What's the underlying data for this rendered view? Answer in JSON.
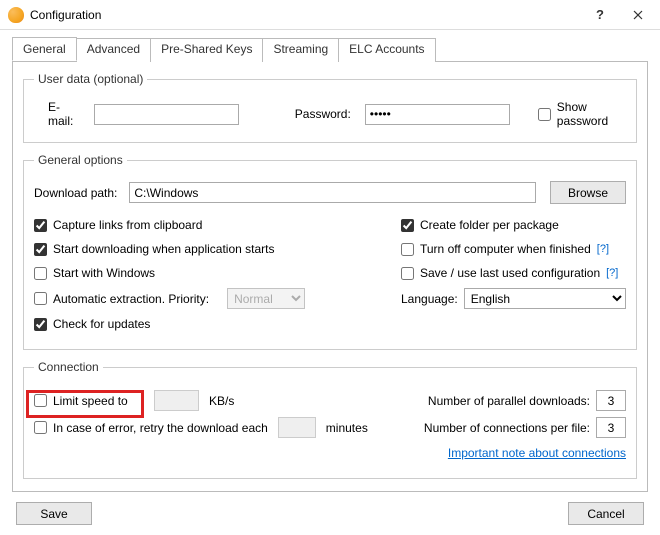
{
  "window": {
    "title": "Configuration"
  },
  "tabs": {
    "general": "General",
    "advanced": "Advanced",
    "preshared": "Pre-Shared Keys",
    "streaming": "Streaming",
    "elc": "ELC Accounts"
  },
  "userdata": {
    "legend": "User data (optional)",
    "email_label": "E-mail:",
    "email_value": "",
    "password_label": "Password:",
    "password_value": "•••••",
    "show_password_label": "Show password",
    "show_password_checked": false
  },
  "general_options": {
    "legend": "General options",
    "download_path_label": "Download path:",
    "download_path_value": "C:\\Windows",
    "browse_label": "Browse",
    "left": {
      "capture_links": {
        "label": "Capture links from clipboard",
        "checked": true
      },
      "start_downloading": {
        "label": "Start downloading when application starts",
        "checked": true
      },
      "start_with_windows": {
        "label": "Start with Windows",
        "checked": false
      },
      "auto_extract": {
        "label": "Automatic extraction. Priority:",
        "checked": false,
        "priority": "Normal"
      },
      "check_updates": {
        "label": "Check for updates",
        "checked": true
      }
    },
    "right": {
      "create_folder": {
        "label": "Create folder per package",
        "checked": true
      },
      "turn_off": {
        "label": "Turn off computer when finished",
        "checked": false
      },
      "save_last": {
        "label": "Save / use last used configuration",
        "checked": false
      },
      "language_label": "Language:",
      "language_value": "English"
    }
  },
  "connection": {
    "legend": "Connection",
    "limit_speed": {
      "label": "Limit speed to",
      "checked": false,
      "units": "KB/s",
      "value": ""
    },
    "retry": {
      "label": "In case of error, retry the download each",
      "checked": false,
      "units": "minutes",
      "value": ""
    },
    "parallel_label": "Number of parallel downloads:",
    "parallel_value": "3",
    "connections_label": "Number of connections per file:",
    "connections_value": "3",
    "note_link": "Important note about connections"
  },
  "buttons": {
    "save": "Save",
    "cancel": "Cancel"
  },
  "help_token": "[?]"
}
